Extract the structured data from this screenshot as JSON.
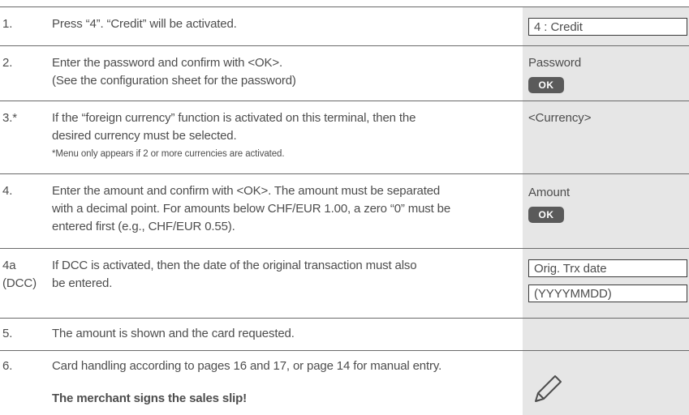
{
  "steps": [
    {
      "num": "1.",
      "text": "Press “4”. “Credit” will be activated.",
      "display": "4 : Credit"
    },
    {
      "num": "2.",
      "line1": "Enter the password and confirm with <OK>.",
      "line2": "(See the configuration sheet for the password)",
      "label": "Password",
      "button": "OK"
    },
    {
      "num": "3.*",
      "line1": "If the “foreign currency” function is activated on this terminal, then the",
      "line2": "desired currency must be selected.",
      "note": "*Menu only appears if 2 or more currencies are activated.",
      "label": "<Currency>"
    },
    {
      "num": "4.",
      "line1": "Enter the amount and confirm with <OK>. The amount must be separated",
      "line2": "with a decimal point. For amounts below CHF/EUR 1.00, a zero “0” must be",
      "line3": "entered first (e.g., CHF/EUR 0.55).",
      "label": "Amount",
      "button": "OK"
    },
    {
      "num_line1": "4a",
      "num_line2": "(DCC)",
      "line1": "If DCC is activated, then the date of the original transaction must also",
      "line2": "be entered.",
      "display1": "Orig. Trx date",
      "display2": "(YYYYMMDD)"
    },
    {
      "num": "5.",
      "text": "The amount is shown and the card requested."
    },
    {
      "num": "6.",
      "text": "Card handling according to pages 16 and 17, or page 14 for manual entry.",
      "bold": "The merchant signs the sales slip!",
      "icon": "pen-icon"
    }
  ]
}
